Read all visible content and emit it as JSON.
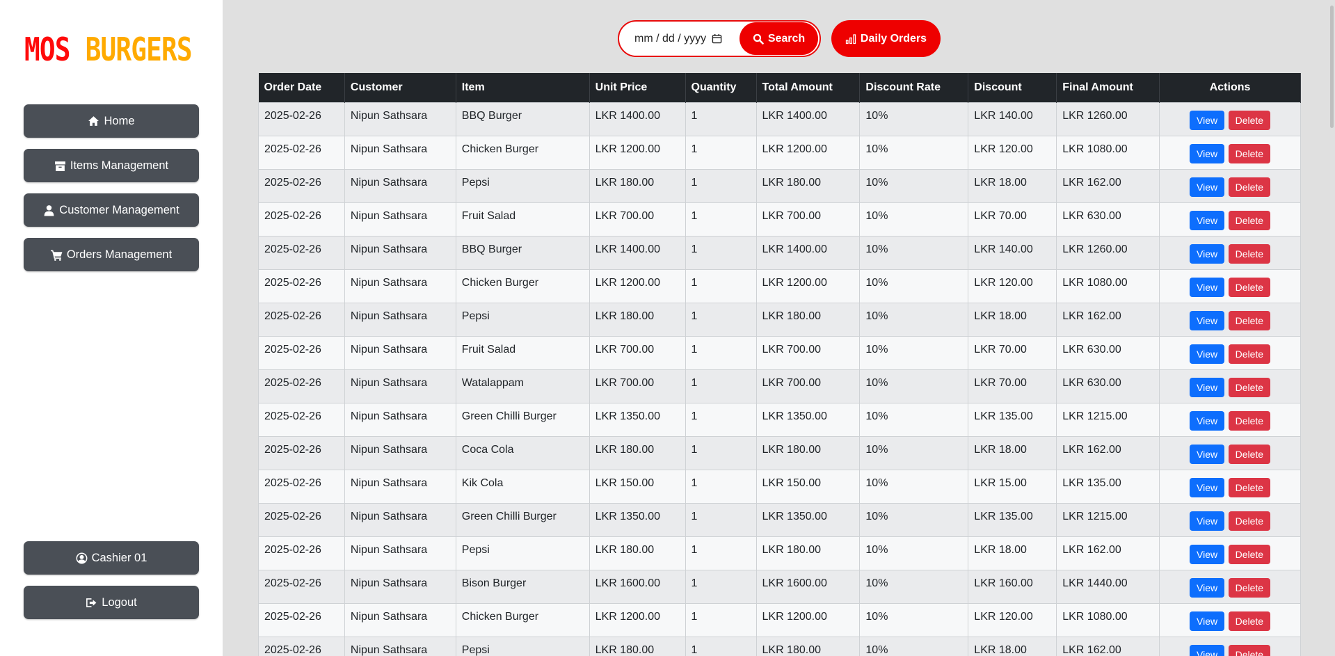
{
  "logo": {
    "part1": "MOS",
    "part2": "BURGERS"
  },
  "sidebar": {
    "items": [
      {
        "label": "Home",
        "icon": "home-icon"
      },
      {
        "label": "Items Management",
        "icon": "box-icon"
      },
      {
        "label": "Customer Management",
        "icon": "user-icon"
      },
      {
        "label": "Orders Management",
        "icon": "cart-icon"
      }
    ],
    "user": {
      "label": "Cashier 01",
      "icon": "user-circle-icon"
    },
    "logout": {
      "label": "Logout",
      "icon": "sign-out-icon"
    }
  },
  "toolbar": {
    "date_placeholder": "mm / dd / yyyy",
    "search_label": "Search",
    "daily_label": "Daily Orders"
  },
  "colors": {
    "accent": "#ee0000",
    "logo_primary": "#ff0a0a",
    "logo_secondary": "#ffaa00",
    "sidebar_button": "#4a4f56",
    "view_button": "#0d6efd",
    "delete_button": "#dc3545"
  },
  "table": {
    "headers": [
      "Order Date",
      "Customer",
      "Item",
      "Unit Price",
      "Quantity",
      "Total Amount",
      "Discount Rate",
      "Discount",
      "Final Amount",
      "Actions"
    ],
    "view_label": "View",
    "delete_label": "Delete",
    "rows": [
      [
        "2025-02-26",
        "Nipun Sathsara",
        "BBQ Burger",
        "LKR 1400.00",
        "1",
        "LKR 1400.00",
        "10%",
        "LKR 140.00",
        "LKR 1260.00"
      ],
      [
        "2025-02-26",
        "Nipun Sathsara",
        "Chicken Burger",
        "LKR 1200.00",
        "1",
        "LKR 1200.00",
        "10%",
        "LKR 120.00",
        "LKR 1080.00"
      ],
      [
        "2025-02-26",
        "Nipun Sathsara",
        "Pepsi",
        "LKR 180.00",
        "1",
        "LKR 180.00",
        "10%",
        "LKR 18.00",
        "LKR 162.00"
      ],
      [
        "2025-02-26",
        "Nipun Sathsara",
        "Fruit Salad",
        "LKR 700.00",
        "1",
        "LKR 700.00",
        "10%",
        "LKR 70.00",
        "LKR 630.00"
      ],
      [
        "2025-02-26",
        "Nipun Sathsara",
        "BBQ Burger",
        "LKR 1400.00",
        "1",
        "LKR 1400.00",
        "10%",
        "LKR 140.00",
        "LKR 1260.00"
      ],
      [
        "2025-02-26",
        "Nipun Sathsara",
        "Chicken Burger",
        "LKR 1200.00",
        "1",
        "LKR 1200.00",
        "10%",
        "LKR 120.00",
        "LKR 1080.00"
      ],
      [
        "2025-02-26",
        "Nipun Sathsara",
        "Pepsi",
        "LKR 180.00",
        "1",
        "LKR 180.00",
        "10%",
        "LKR 18.00",
        "LKR 162.00"
      ],
      [
        "2025-02-26",
        "Nipun Sathsara",
        "Fruit Salad",
        "LKR 700.00",
        "1",
        "LKR 700.00",
        "10%",
        "LKR 70.00",
        "LKR 630.00"
      ],
      [
        "2025-02-26",
        "Nipun Sathsara",
        "Watalappam",
        "LKR 700.00",
        "1",
        "LKR 700.00",
        "10%",
        "LKR 70.00",
        "LKR 630.00"
      ],
      [
        "2025-02-26",
        "Nipun Sathsara",
        "Green Chilli Burger",
        "LKR 1350.00",
        "1",
        "LKR 1350.00",
        "10%",
        "LKR 135.00",
        "LKR 1215.00"
      ],
      [
        "2025-02-26",
        "Nipun Sathsara",
        "Coca Cola",
        "LKR 180.00",
        "1",
        "LKR 180.00",
        "10%",
        "LKR 18.00",
        "LKR 162.00"
      ],
      [
        "2025-02-26",
        "Nipun Sathsara",
        "Kik Cola",
        "LKR 150.00",
        "1",
        "LKR 150.00",
        "10%",
        "LKR 15.00",
        "LKR 135.00"
      ],
      [
        "2025-02-26",
        "Nipun Sathsara",
        "Green Chilli Burger",
        "LKR 1350.00",
        "1",
        "LKR 1350.00",
        "10%",
        "LKR 135.00",
        "LKR 1215.00"
      ],
      [
        "2025-02-26",
        "Nipun Sathsara",
        "Pepsi",
        "LKR 180.00",
        "1",
        "LKR 180.00",
        "10%",
        "LKR 18.00",
        "LKR 162.00"
      ],
      [
        "2025-02-26",
        "Nipun Sathsara",
        "Bison Burger",
        "LKR 1600.00",
        "1",
        "LKR 1600.00",
        "10%",
        "LKR 160.00",
        "LKR 1440.00"
      ],
      [
        "2025-02-26",
        "Nipun Sathsara",
        "Chicken Burger",
        "LKR 1200.00",
        "1",
        "LKR 1200.00",
        "10%",
        "LKR 120.00",
        "LKR 1080.00"
      ],
      [
        "2025-02-26",
        "Nipun Sathsara",
        "Pepsi",
        "LKR 180.00",
        "1",
        "LKR 180.00",
        "10%",
        "LKR 18.00",
        "LKR 162.00"
      ]
    ]
  }
}
